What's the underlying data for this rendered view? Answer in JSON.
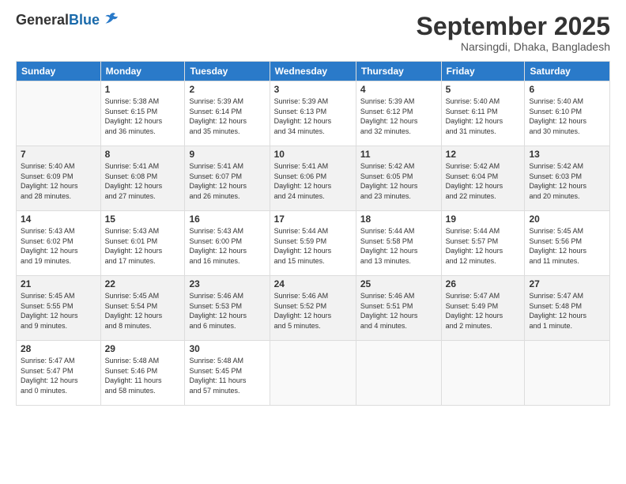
{
  "logo": {
    "general": "General",
    "blue": "Blue"
  },
  "title": "September 2025",
  "location": "Narsingdi, Dhaka, Bangladesh",
  "days_header": [
    "Sunday",
    "Monday",
    "Tuesday",
    "Wednesday",
    "Thursday",
    "Friday",
    "Saturday"
  ],
  "weeks": [
    [
      {
        "day": "",
        "info": ""
      },
      {
        "day": "1",
        "info": "Sunrise: 5:38 AM\nSunset: 6:15 PM\nDaylight: 12 hours\nand 36 minutes."
      },
      {
        "day": "2",
        "info": "Sunrise: 5:39 AM\nSunset: 6:14 PM\nDaylight: 12 hours\nand 35 minutes."
      },
      {
        "day": "3",
        "info": "Sunrise: 5:39 AM\nSunset: 6:13 PM\nDaylight: 12 hours\nand 34 minutes."
      },
      {
        "day": "4",
        "info": "Sunrise: 5:39 AM\nSunset: 6:12 PM\nDaylight: 12 hours\nand 32 minutes."
      },
      {
        "day": "5",
        "info": "Sunrise: 5:40 AM\nSunset: 6:11 PM\nDaylight: 12 hours\nand 31 minutes."
      },
      {
        "day": "6",
        "info": "Sunrise: 5:40 AM\nSunset: 6:10 PM\nDaylight: 12 hours\nand 30 minutes."
      }
    ],
    [
      {
        "day": "7",
        "info": "Sunrise: 5:40 AM\nSunset: 6:09 PM\nDaylight: 12 hours\nand 28 minutes."
      },
      {
        "day": "8",
        "info": "Sunrise: 5:41 AM\nSunset: 6:08 PM\nDaylight: 12 hours\nand 27 minutes."
      },
      {
        "day": "9",
        "info": "Sunrise: 5:41 AM\nSunset: 6:07 PM\nDaylight: 12 hours\nand 26 minutes."
      },
      {
        "day": "10",
        "info": "Sunrise: 5:41 AM\nSunset: 6:06 PM\nDaylight: 12 hours\nand 24 minutes."
      },
      {
        "day": "11",
        "info": "Sunrise: 5:42 AM\nSunset: 6:05 PM\nDaylight: 12 hours\nand 23 minutes."
      },
      {
        "day": "12",
        "info": "Sunrise: 5:42 AM\nSunset: 6:04 PM\nDaylight: 12 hours\nand 22 minutes."
      },
      {
        "day": "13",
        "info": "Sunrise: 5:42 AM\nSunset: 6:03 PM\nDaylight: 12 hours\nand 20 minutes."
      }
    ],
    [
      {
        "day": "14",
        "info": "Sunrise: 5:43 AM\nSunset: 6:02 PM\nDaylight: 12 hours\nand 19 minutes."
      },
      {
        "day": "15",
        "info": "Sunrise: 5:43 AM\nSunset: 6:01 PM\nDaylight: 12 hours\nand 17 minutes."
      },
      {
        "day": "16",
        "info": "Sunrise: 5:43 AM\nSunset: 6:00 PM\nDaylight: 12 hours\nand 16 minutes."
      },
      {
        "day": "17",
        "info": "Sunrise: 5:44 AM\nSunset: 5:59 PM\nDaylight: 12 hours\nand 15 minutes."
      },
      {
        "day": "18",
        "info": "Sunrise: 5:44 AM\nSunset: 5:58 PM\nDaylight: 12 hours\nand 13 minutes."
      },
      {
        "day": "19",
        "info": "Sunrise: 5:44 AM\nSunset: 5:57 PM\nDaylight: 12 hours\nand 12 minutes."
      },
      {
        "day": "20",
        "info": "Sunrise: 5:45 AM\nSunset: 5:56 PM\nDaylight: 12 hours\nand 11 minutes."
      }
    ],
    [
      {
        "day": "21",
        "info": "Sunrise: 5:45 AM\nSunset: 5:55 PM\nDaylight: 12 hours\nand 9 minutes."
      },
      {
        "day": "22",
        "info": "Sunrise: 5:45 AM\nSunset: 5:54 PM\nDaylight: 12 hours\nand 8 minutes."
      },
      {
        "day": "23",
        "info": "Sunrise: 5:46 AM\nSunset: 5:53 PM\nDaylight: 12 hours\nand 6 minutes."
      },
      {
        "day": "24",
        "info": "Sunrise: 5:46 AM\nSunset: 5:52 PM\nDaylight: 12 hours\nand 5 minutes."
      },
      {
        "day": "25",
        "info": "Sunrise: 5:46 AM\nSunset: 5:51 PM\nDaylight: 12 hours\nand 4 minutes."
      },
      {
        "day": "26",
        "info": "Sunrise: 5:47 AM\nSunset: 5:49 PM\nDaylight: 12 hours\nand 2 minutes."
      },
      {
        "day": "27",
        "info": "Sunrise: 5:47 AM\nSunset: 5:48 PM\nDaylight: 12 hours\nand 1 minute."
      }
    ],
    [
      {
        "day": "28",
        "info": "Sunrise: 5:47 AM\nSunset: 5:47 PM\nDaylight: 12 hours\nand 0 minutes."
      },
      {
        "day": "29",
        "info": "Sunrise: 5:48 AM\nSunset: 5:46 PM\nDaylight: 11 hours\nand 58 minutes."
      },
      {
        "day": "30",
        "info": "Sunrise: 5:48 AM\nSunset: 5:45 PM\nDaylight: 11 hours\nand 57 minutes."
      },
      {
        "day": "",
        "info": ""
      },
      {
        "day": "",
        "info": ""
      },
      {
        "day": "",
        "info": ""
      },
      {
        "day": "",
        "info": ""
      }
    ]
  ]
}
